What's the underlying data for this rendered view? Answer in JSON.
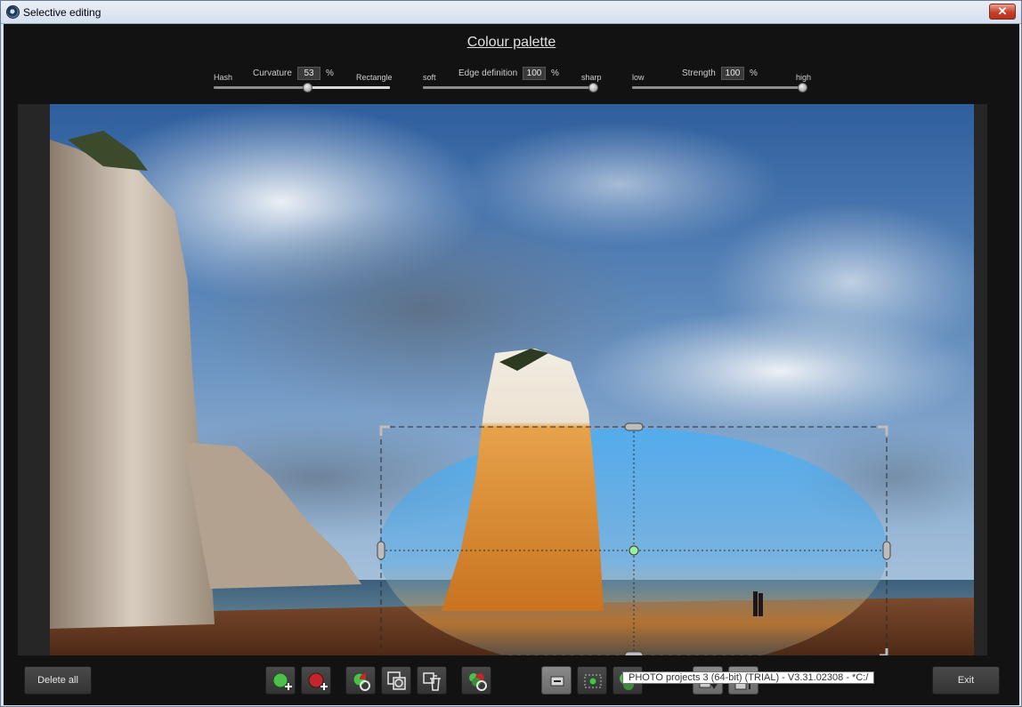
{
  "window": {
    "title": "Selective editing",
    "close_label": "✕"
  },
  "palette_title": "Colour palette",
  "sliders": {
    "curvature": {
      "left_label": "Hash",
      "name": "Curvature",
      "value": "53",
      "unit": "%",
      "right_label": "Rectangle",
      "level": 0.53
    },
    "edge": {
      "left_label": "soft",
      "name": "Edge definition",
      "value": "100",
      "unit": "%",
      "right_label": "sharp",
      "level": 1.0
    },
    "strength": {
      "left_label": "low",
      "name": "Strength",
      "value": "100",
      "unit": "%",
      "right_label": "high",
      "level": 1.0
    }
  },
  "buttons": {
    "delete_all": "Delete all",
    "exit": "Exit"
  },
  "tools": [
    {
      "name": "add-green-mask-icon"
    },
    {
      "name": "add-red-mask-icon"
    },
    {
      "name": "rotate-mask-icon"
    },
    {
      "name": "copy-mask-icon"
    },
    {
      "name": "trash-mask-icon"
    },
    {
      "name": "mask-options-icon"
    },
    {
      "name": "minus-icon"
    },
    {
      "name": "center-point-icon"
    },
    {
      "name": "mask-colors-icon"
    },
    {
      "name": "move-down-icon"
    },
    {
      "name": "move-up-icon"
    }
  ],
  "status_tooltip": "PHOTO projects 3 (64-bit) (TRIAL) - V3.31.02308 - *C:/",
  "colors": {
    "accent_green": "#4cc04a",
    "accent_red": "#c0262b",
    "handle_green": "#9cf09a"
  }
}
